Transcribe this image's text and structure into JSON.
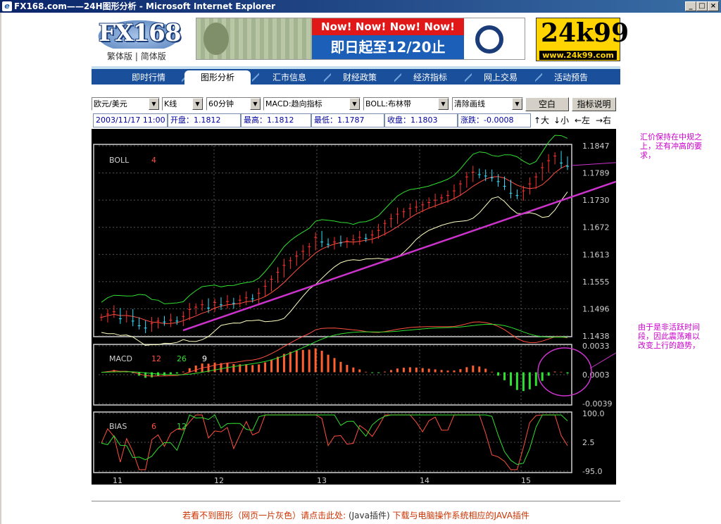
{
  "window": {
    "title": "FX168.com——24H图形分析 - Microsoft Internet Explorer",
    "controls": [
      "_",
      "□",
      "×"
    ]
  },
  "header": {
    "fx_logo": "FX168",
    "lang_links": [
      "繁体版",
      "简体版"
    ],
    "banner_now": "Now! Now! Now! Now!",
    "banner_promo": "即日起至12/20止",
    "logo_24k": "24k99",
    "logo_24k_url": "www.24k99.com"
  },
  "nav": {
    "tabs": [
      {
        "label": "即时行情",
        "active": false
      },
      {
        "label": "图形分析",
        "active": true
      },
      {
        "label": "汇市信息",
        "active": false
      },
      {
        "label": "财经政策",
        "active": false
      },
      {
        "label": "经济指标",
        "active": false
      },
      {
        "label": "网上交易",
        "active": false
      },
      {
        "label": "活动预告",
        "active": false
      }
    ]
  },
  "toolbar": {
    "pair": "欧元/美元",
    "chart_type": "K线",
    "period": "60分钟",
    "indicator1": "MACD:趋向指标",
    "indicator2": "BOLL:布林带",
    "draw": "清除画线",
    "blank_button": "空白",
    "help_button": "指标说明"
  },
  "info": {
    "datetime": "2003/11/17 11:00",
    "open": "开盘：1.1812",
    "high": "最高：1.1812",
    "low": "最低：1.1787",
    "close": "收盘：1.1803",
    "change": "涨跌：-0.0008",
    "zoom_in": "↑大",
    "zoom_out": "↓小",
    "left": "←左",
    "right": "→右"
  },
  "chart_data": {
    "type": "line",
    "panels": [
      {
        "name": "BOLL",
        "param": "4",
        "y_ticks": [
          "1.1847",
          "1.1789",
          "1.1730",
          "1.1672",
          "1.1613",
          "1.1555",
          "1.1496",
          "1.1438"
        ],
        "ylim": [
          1.1438,
          1.1847
        ]
      },
      {
        "name": "MACD",
        "params": [
          "12",
          "26",
          "9"
        ],
        "y_ticks": [
          "0.0033",
          "0.0003",
          "-0.0039"
        ],
        "ylim": [
          -0.0039,
          0.0033
        ]
      },
      {
        "name": "BIAS",
        "params": [
          "6",
          "12"
        ],
        "y_ticks": [
          "100.0",
          "2.5",
          "-95.0"
        ],
        "ylim": [
          -95.0,
          100.0
        ]
      }
    ],
    "x_ticks": [
      "11",
      "12",
      "13",
      "14",
      "15"
    ],
    "price_close": [
      1.1478,
      1.1485,
      1.149,
      1.1475,
      1.1482,
      1.147,
      1.146,
      1.1455,
      1.1465,
      1.147,
      1.1468,
      1.1472,
      1.147,
      1.148,
      1.1495,
      1.15,
      1.1505,
      1.1498,
      1.151,
      1.1505,
      1.1512,
      1.1508,
      1.1515,
      1.152,
      1.1518,
      1.153,
      1.1545,
      1.156,
      1.1575,
      1.159,
      1.16,
      1.161,
      1.162,
      1.163,
      1.165,
      1.164,
      1.1635,
      1.164,
      1.1638,
      1.1642,
      1.1645,
      1.165,
      1.1648,
      1.1655,
      1.1665,
      1.168,
      1.169,
      1.17,
      1.1705,
      1.1712,
      1.1715,
      1.172,
      1.1725,
      1.173,
      1.1735,
      1.174,
      1.175,
      1.1765,
      1.178,
      1.179,
      1.1785,
      1.1782,
      1.1778,
      1.177,
      1.176,
      1.1745,
      1.174,
      1.175,
      1.1765,
      1.178,
      1.18,
      1.1815,
      1.1825,
      1.181,
      1.1803
    ],
    "annotations": [
      "汇价保持在中规之上，还有冲高的要求，",
      "由于是非活跃时间段，因此震荡难以改变上行的趋势，"
    ]
  },
  "footer": {
    "text": "若看不到图形（网页一片灰色）请点击此处:",
    "plugin": "(Java插件)",
    "download": "下载与电脑操作系统相应的JAVA插件"
  },
  "colors": {
    "title_bar": "#0a246a",
    "nav_bg": "#1a4f9c",
    "chart_bg": "#000000",
    "trendline": "#cc33cc",
    "annotation": "#cc00cc"
  }
}
